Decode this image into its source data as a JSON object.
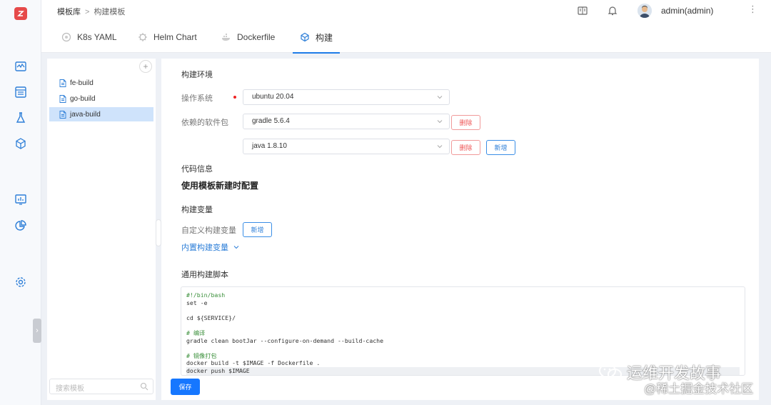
{
  "breadcrumb": {
    "root": "模板库",
    "separator": ">",
    "current": "构建模板"
  },
  "user": {
    "name": "admin(admin)"
  },
  "tabs": [
    {
      "label": "K8s YAML",
      "icon": "k8s-icon"
    },
    {
      "label": "Helm Chart",
      "icon": "helm-icon"
    },
    {
      "label": "Dockerfile",
      "icon": "docker-icon"
    },
    {
      "label": "构建",
      "icon": "build-cube-icon",
      "active": true
    }
  ],
  "template_list": {
    "add_label": "+",
    "items": [
      {
        "label": "fe-build",
        "selected": false
      },
      {
        "label": "go-build",
        "selected": false
      },
      {
        "label": "java-build",
        "selected": true
      }
    ],
    "search_placeholder": "搜索模板"
  },
  "build_env": {
    "section_title": "构建环境",
    "os_label": "操作系统",
    "os_value": "ubuntu 20.04",
    "deps_label": "依赖的软件包",
    "deps": [
      {
        "value": "gradle 5.6.4",
        "delete_label": "删除"
      },
      {
        "value": "java 1.8.10",
        "delete_label": "删除"
      }
    ],
    "add_label": "新增"
  },
  "code_info": {
    "section_title": "代码信息",
    "value": "使用模板新建时配置"
  },
  "build_vars": {
    "section_title": "构建变量",
    "custom_label": "自定义构建变量",
    "add_label": "新增",
    "builtin_link": "内置构建变量"
  },
  "script": {
    "section_title": "通用构建脚本",
    "lines": [
      "#!/bin/bash",
      "set -e",
      "",
      "cd ${SERVICE}/",
      "",
      "# 编译",
      "gradle clean bootJar --configure-on-demand --build-cache",
      "",
      "# 镜像打包",
      "docker build -t $IMAGE -f Dockerfile .",
      "docker push $IMAGE"
    ]
  },
  "save_label": "保存",
  "watermark": {
    "line1": "运维开发故事",
    "line2": "@稀土掘金技术社区"
  },
  "colors": {
    "primary": "#1677ff",
    "danger": "#e55555",
    "logo": "#e64a4a"
  }
}
